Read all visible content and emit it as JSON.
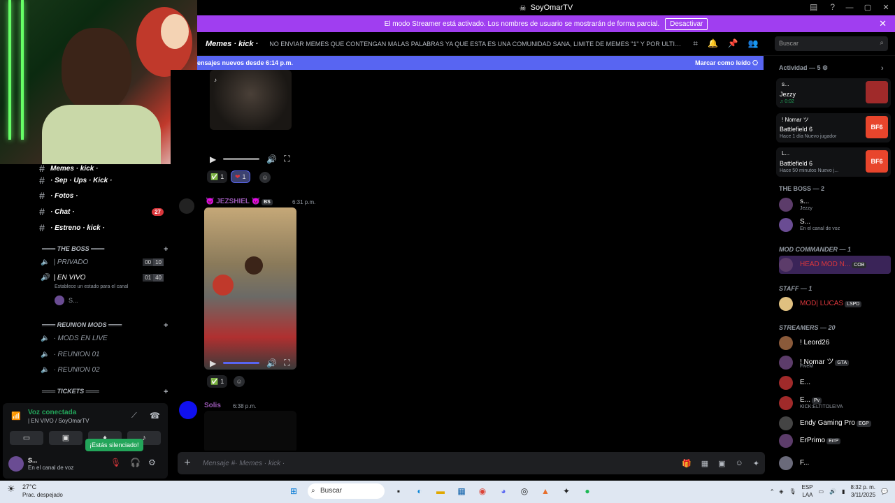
{
  "titlebar": {
    "title": "SoyOmarTV"
  },
  "streamer_banner": {
    "message": "El modo Streamer está activado. Los nombres de usuario se mostrarán de forma parcial.",
    "button": "Desactivar"
  },
  "channel_header": {
    "name": "Memes · kick ·",
    "topic": "NO ENVIAR MEMES QUE CONTENGAN MALAS PALABRAS YA QUE ESTA ES UNA COMUNIDAD SANA, LIMITE DE MEMES \"1\" Y POR ULTIMO EL ...",
    "search_placeholder": "Buscar"
  },
  "new_messages": {
    "text": "ensajes nuevos desde 6:14 p.m.",
    "action": "Marcar como leído"
  },
  "sidebar": {
    "channels": [
      {
        "name": "Memes · kick ·"
      },
      {
        "name": "· Sep · Ups · Kick ·"
      },
      {
        "name": "· Fotos ·"
      },
      {
        "name": "· Chat ·",
        "badge": "27"
      },
      {
        "name": "· Estreno · kick ·"
      }
    ],
    "categories": {
      "boss": "THE BOSS",
      "reunion": "REUNION MODS",
      "tickets": "TICKETS"
    },
    "voice_channels": [
      {
        "name": "| PRIVADO",
        "count": "00",
        "limit": "10"
      },
      {
        "name": "| EN VIVO",
        "count": "01",
        "limit": "40",
        "sub": "Establece un estado para el canal"
      },
      {
        "name": "· MODS EN LIVE"
      },
      {
        "name": "· REUNION 01"
      },
      {
        "name": "· REUNION 02"
      }
    ],
    "voice_user": "S..."
  },
  "voice_panel": {
    "status": "Voz conectada",
    "channel": "| EN VIVO / SoyOmarTV",
    "tooltip": "¡Estás silenciado!",
    "user_name": "S...",
    "user_status": "En el canal de voz"
  },
  "chat": {
    "messages": [
      {
        "reactions": [
          {
            "emoji": "✅",
            "count": "1"
          },
          {
            "emoji": "❤",
            "count": "1"
          }
        ]
      },
      {
        "author": "JEZSHIEL",
        "tag": "BS",
        "time": "6:31 p.m.",
        "reactions": [
          {
            "emoji": "✅",
            "count": "1"
          }
        ]
      },
      {
        "author": "Solis",
        "time": "6:38 p.m."
      }
    ]
  },
  "composer": {
    "placeholder": "Mensaje #· Memes · kick ·"
  },
  "members": {
    "activity_header": "Actividad — 5",
    "activity": [
      {
        "name": "s...",
        "game": "Jezzy",
        "meta": "0:02",
        "thumb": ""
      },
      {
        "name": "! Nomar ツ",
        "game": "Battlefield 6",
        "meta": "Hace 1 día  Nuevo jugador",
        "thumb": "BF6"
      },
      {
        "name": "L...",
        "game": "Battlefield 6",
        "meta": "Hace 50 minutos  Nuevo j...",
        "thumb": "BF6"
      }
    ],
    "groups": [
      {
        "head": "THE BOSS — 2",
        "members": [
          {
            "name": "s...",
            "sub": "Jezzy"
          },
          {
            "name": "S...",
            "sub": "En el canal de voz"
          }
        ]
      },
      {
        "head": "MOD COMMANDER — 1",
        "members": [
          {
            "name": "HEAD MOD N...",
            "tag": "COB",
            "color": "#da373c"
          }
        ]
      },
      {
        "head": "STAFF — 1",
        "members": [
          {
            "name": "MOD| LUCAS",
            "tag": "LSPD",
            "color": "#da373c"
          }
        ]
      },
      {
        "head": "STREAMERS — 20",
        "members": [
          {
            "name": "! Leord26"
          },
          {
            "name": "! Nomar ツ",
            "tag": "GTA",
            "sub": "FiveM"
          },
          {
            "name": "E..."
          },
          {
            "name": "E...",
            "tag": "Pv",
            "sub": "KICK:ELTITOLEIVA"
          },
          {
            "name": "Endy Gaming Pro",
            "tag": "EGP"
          },
          {
            "name": "ErPrimo",
            "tag": "ErrP"
          },
          {
            "name": "F..."
          }
        ]
      }
    ]
  },
  "taskbar": {
    "temp": "27°C",
    "weather": "Prac. despejado",
    "search": "Buscar",
    "lang": "ESP",
    "lang2": "LAA",
    "time": "8:32 p. m.",
    "date": "3/11/2025"
  },
  "colors": {
    "accent": "#5865f2",
    "banner": "#a03ef0",
    "online": "#23a55a",
    "danger": "#da373c"
  }
}
